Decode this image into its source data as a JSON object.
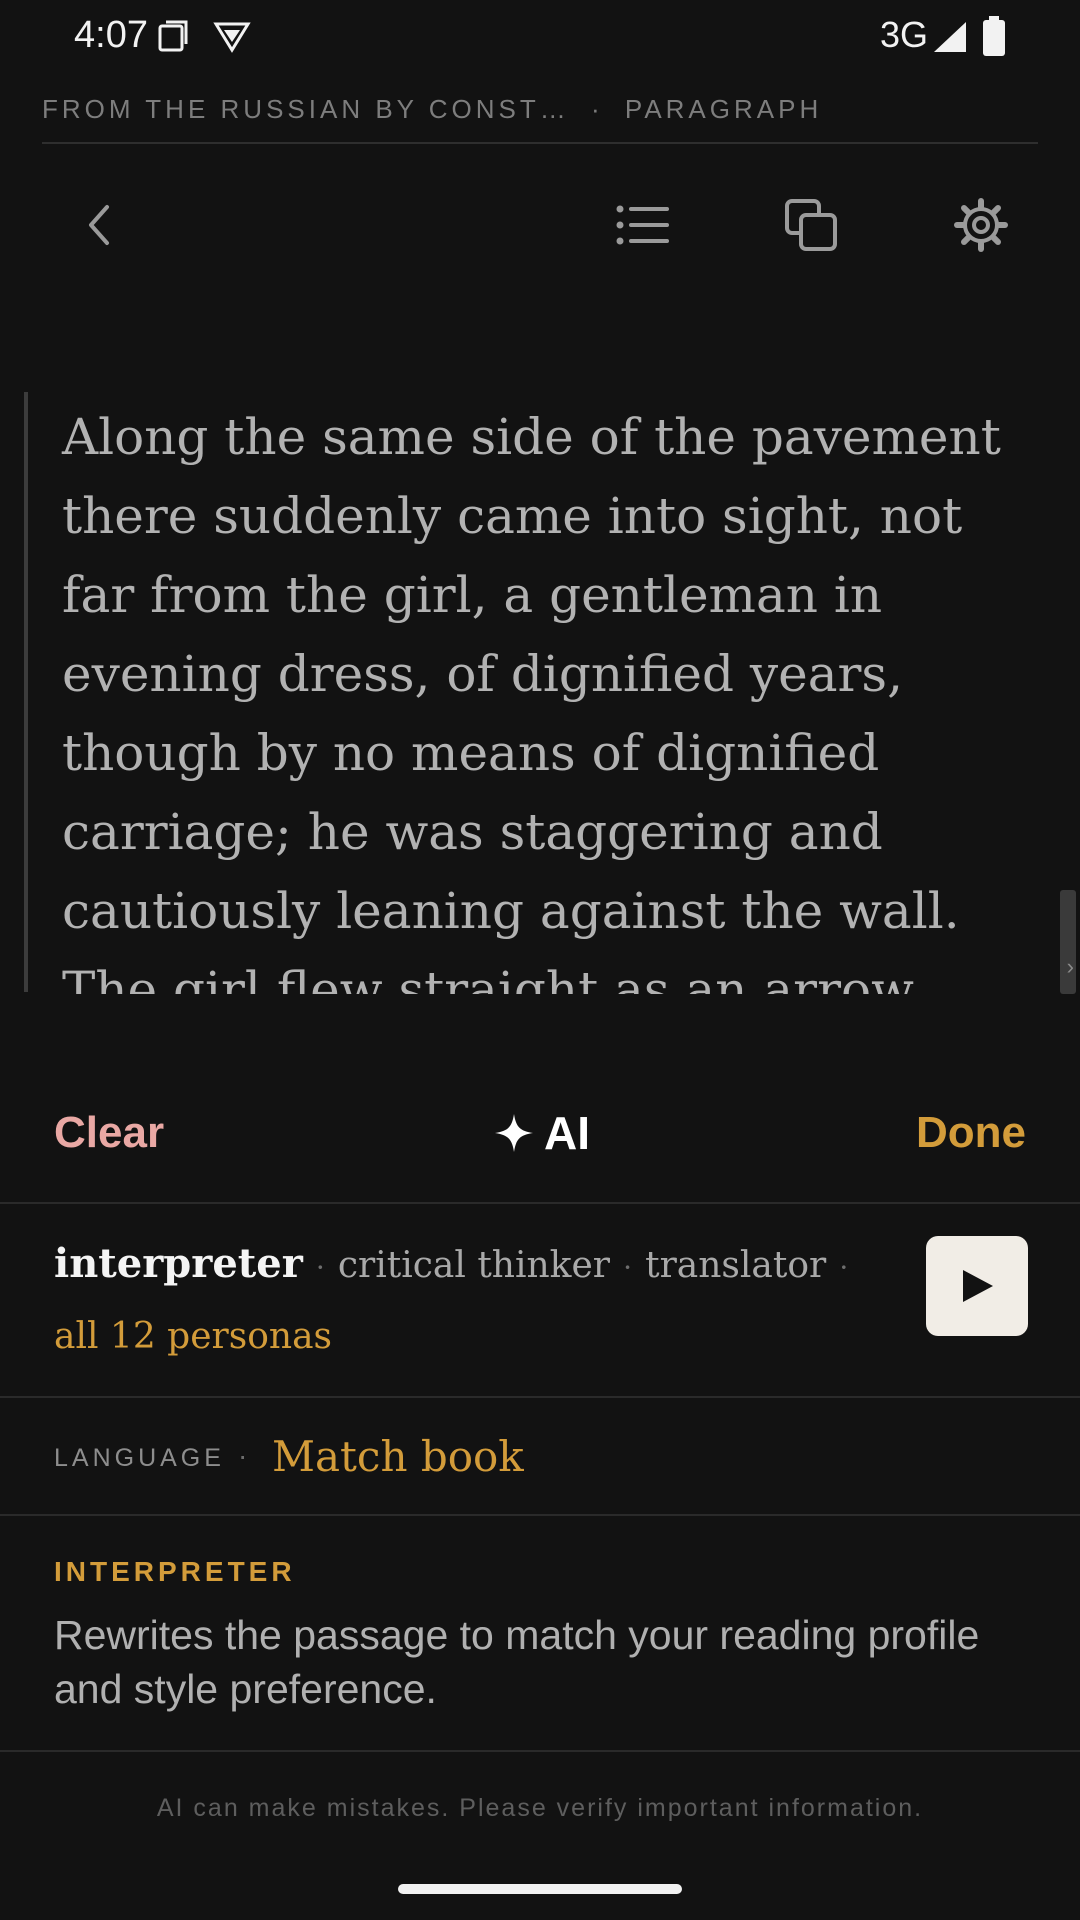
{
  "status": {
    "time": "4:07",
    "network": "3G",
    "icons": [
      "screenshot-icon",
      "vpn-shield-icon",
      "signal-icon",
      "battery-icon"
    ]
  },
  "breadcrumb": {
    "source": "FROM THE RUSSIAN BY CONST…",
    "separator": "·",
    "mode": "PARAGRAPH"
  },
  "toolbar": {
    "icons": [
      "back-chevron-icon",
      "list-icon",
      "copy-icon",
      "gear-icon"
    ]
  },
  "passage": {
    "text": "Along the same side of the pavement there suddenly came into sight, not far from the girl, a gentleman in evening dress, of dignified years, though by no means of dignified carriage; he was staggering and cautiously leaning against the wall. The girl flew straight as an arrow, with the timid haste one"
  },
  "actions": {
    "clear": "Clear",
    "ai": "AI",
    "done": "Done"
  },
  "persona": {
    "primary": "interpreter",
    "alternates": [
      "critical thinker",
      "translator"
    ],
    "separator": "·",
    "all_link": "all 12 personas",
    "play_icon": "play-icon"
  },
  "language": {
    "label": "LANGUAGE",
    "separator": "·",
    "value": "Match book"
  },
  "description": {
    "title": "INTERPRETER",
    "text": "Rewrites the passage to match your reading profile and style preference."
  },
  "disclaimer": "AI can make mistakes. Please verify important information.",
  "colors": {
    "background": "#121212",
    "accent": "#d39c3a",
    "clear": "#e9a8a4",
    "passage_text": "#b2b2b2"
  }
}
